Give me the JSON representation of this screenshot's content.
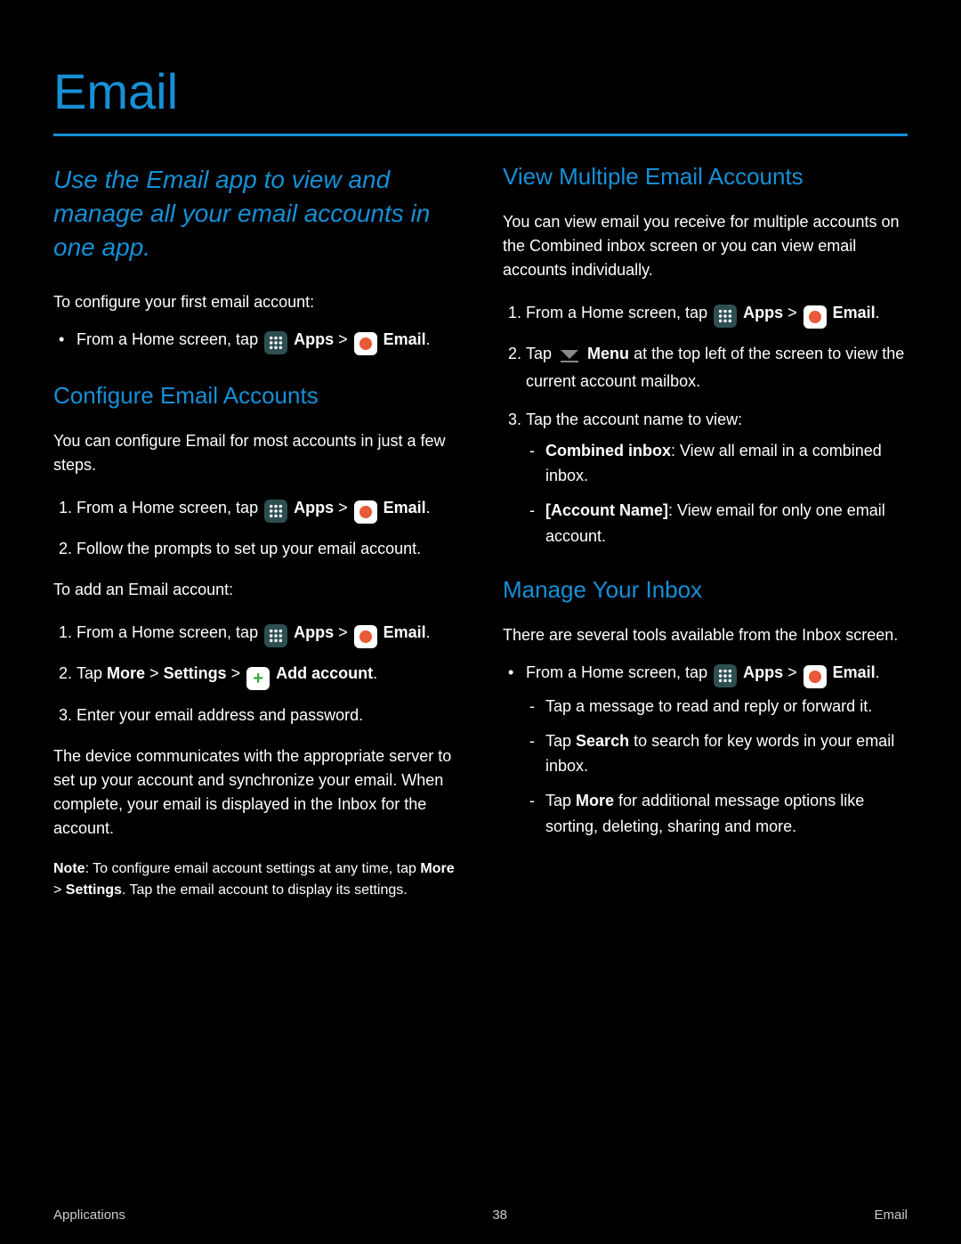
{
  "header": "Email",
  "intro": "Use the Email app to view and manage all your email accounts in one app.",
  "left": {
    "config_line_prefix": "To configure your first email account:",
    "bullet_from_home_1": "From a Home screen, tap ",
    "apps_label": "Apps",
    "greater": " > ",
    "email_label": "Email",
    "period": ".",
    "h2_configure": "Configure Email Accounts",
    "p_configure1": "You can configure Email for most accounts in just a few steps.",
    "bullet_from_home_2": "From a Home screen, tap ",
    "step_follow": "Follow the prompts to set up your email account.",
    "p_configure2": "To add an Email account:",
    "bullet_from_home_3": "From a Home screen, tap ",
    "step_tap_more_add": "Tap More > Settings > ",
    "add_account_label": "Add account",
    "step_enter_follow": "Enter your email address and password.",
    "p_auto": "The device communicates with the appropriate server to set up your account and synchronize your email. When complete, your email is displayed in the Inbox for the account.",
    "note_bold": "Note",
    "note_body": ": To configure email account settings at any time, tap ",
    "note_more": "More",
    "note_gt": " > ",
    "note_settings": "Settings",
    "note_tail": ". Tap the email account to display its settings."
  },
  "right": {
    "h2_view": "View Multiple Email Accounts",
    "p_view": "You can view email you receive for multiple accounts on the Combined inbox screen or you can view email accounts individually.",
    "bullet_from_home_4": "From a Home screen, tap ",
    "step_tap_menu": "Tap ",
    "menu_label": "Menu",
    "step_tap_menu_tail": " at the top left of the screen to view the current account mailbox.",
    "step_tap_account": "Tap the account name to view:",
    "sub_combined_bold": "Combined inbox",
    "sub_combined_body": ": View all email in a combined inbox.",
    "sub_account_bold": "[Account Name]",
    "sub_account_body": ": View email for only one email account.",
    "h2_manage": "Manage Your Inbox",
    "p_manage": "There are several tools available from the Inbox screen.",
    "bullet_from_home_5": "From a Home screen, tap ",
    "manage_tap_read": "Tap a message to read and reply or forward it.",
    "manage_search": "Tap ",
    "manage_search_bold": "Search",
    "manage_search_tail": " to search for key words in your email inbox.",
    "manage_more": "Tap ",
    "manage_more_bold": "More",
    "manage_more_tail": " for additional message options like sorting, deleting, sharing and more."
  },
  "footer": {
    "left": "Applications",
    "center": "38",
    "right": "Email"
  }
}
